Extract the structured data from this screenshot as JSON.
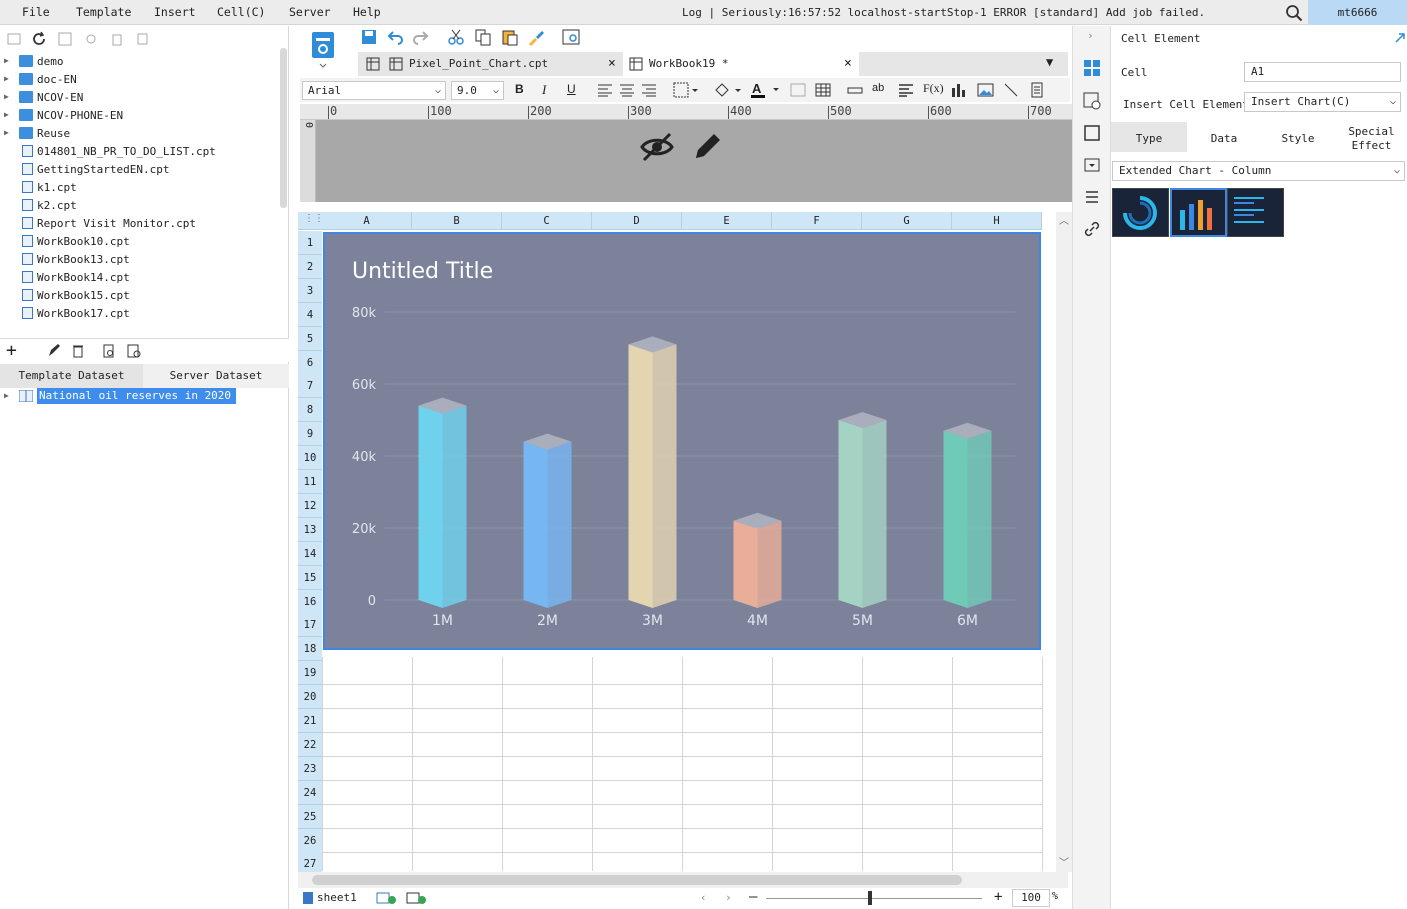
{
  "menubar": {
    "items": [
      "File",
      "Template",
      "Insert",
      "Cell(C)",
      "Server",
      "Help"
    ],
    "log": "Log | Seriously:16:57:52 localhost-startStop-1 ERROR [standard] Add job failed.",
    "user": "mt6666"
  },
  "left_panel": {
    "tree": [
      {
        "label": "demo",
        "kind": "folder"
      },
      {
        "label": "doc-EN",
        "kind": "folder"
      },
      {
        "label": "NCOV-EN",
        "kind": "folder"
      },
      {
        "label": "NCOV-PHONE-EN",
        "kind": "folder"
      },
      {
        "label": "Reuse",
        "kind": "folder"
      },
      {
        "label": "014801_NB_PR_TO_DO_LIST.cpt",
        "kind": "file"
      },
      {
        "label": "GettingStartedEN.cpt",
        "kind": "file"
      },
      {
        "label": "k1.cpt",
        "kind": "file"
      },
      {
        "label": "k2.cpt",
        "kind": "file"
      },
      {
        "label": "Report Visit Monitor.cpt",
        "kind": "file"
      },
      {
        "label": "WorkBook10.cpt",
        "kind": "file"
      },
      {
        "label": "WorkBook13.cpt",
        "kind": "file"
      },
      {
        "label": "WorkBook14.cpt",
        "kind": "file"
      },
      {
        "label": "WorkBook15.cpt",
        "kind": "file"
      },
      {
        "label": "WorkBook17.cpt",
        "kind": "file"
      }
    ],
    "dataset_tabs": [
      "Template Dataset",
      "Server Dataset"
    ],
    "dataset_item": "National oil reserves in 2020"
  },
  "doc_tabs": [
    "Pixel_Point_Chart.cpt",
    "WorkBook19 *"
  ],
  "format_bar": {
    "font": "Arial",
    "size": "9.0"
  },
  "ruler": [
    "0",
    "100",
    "200",
    "300",
    "400",
    "500",
    "600",
    "700"
  ],
  "sheet": {
    "columns": [
      "A",
      "B",
      "C",
      "D",
      "E",
      "F",
      "G",
      "H"
    ],
    "rows": [
      "1",
      "2",
      "3",
      "4",
      "5",
      "6",
      "7",
      "8",
      "9",
      "10",
      "11",
      "12",
      "13",
      "14",
      "15",
      "16",
      "17",
      "18",
      "19",
      "20",
      "21",
      "22",
      "23",
      "24",
      "25",
      "26",
      "27"
    ],
    "tab": "sheet1",
    "zoom": "100",
    "zoom_unit": "%"
  },
  "chart_data": {
    "type": "bar",
    "title": "Untitled Title",
    "categories": [
      "1M",
      "2M",
      "3M",
      "4M",
      "5M",
      "6M"
    ],
    "values": [
      54000,
      44000,
      71000,
      22000,
      50000,
      47000
    ],
    "yticks": [
      "0",
      "20k",
      "40k",
      "60k",
      "80k"
    ],
    "ylim": [
      0,
      80000
    ],
    "colors": [
      "#6fd6f0",
      "#77b9f6",
      "#ead9b2",
      "#eeb09a",
      "#a6d7c6",
      "#70cdb9"
    ],
    "background": "#7b8299"
  },
  "right_panel": {
    "title": "Cell Element",
    "cell_label": "Cell",
    "cell_value": "A1",
    "insert_label": "Insert Cell Element",
    "insert_value": "Insert Chart(C)",
    "tabs": [
      "Type",
      "Data",
      "Style",
      "Special Effect"
    ],
    "chart_type": "Extended Chart - Column"
  }
}
